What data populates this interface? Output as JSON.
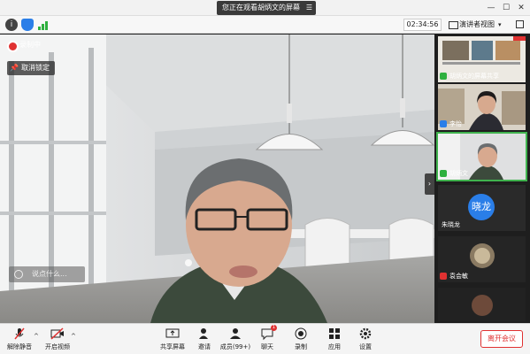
{
  "titlebar": {
    "share_banner": "您正在观看胡炳文的屏幕",
    "menu_glyph": "☰",
    "minimize": "—",
    "maximize": "☐",
    "close": "✕"
  },
  "toolbar": {
    "timer": "02:34:56",
    "speaker_view": "演讲者视图",
    "speaker_view_chevron": "▾"
  },
  "main": {
    "recording": "录制中",
    "unpin": "取消锁定",
    "chat_placeholder": "说点什么...",
    "collapse": "›"
  },
  "participants": [
    {
      "name": "胡炳文的屏幕共享",
      "mic": "green",
      "type": "screen"
    },
    {
      "name": "李怡",
      "mic": "blue",
      "type": "video"
    },
    {
      "name": "胡炳文",
      "mic": "green",
      "type": "video"
    },
    {
      "name": "朱晓龙",
      "mic": "none",
      "type": "avatar",
      "avatar_text": "晓龙"
    },
    {
      "name": "袁会敏",
      "mic": "red",
      "type": "video"
    },
    {
      "name": "",
      "mic": "none",
      "type": "video"
    }
  ],
  "bottombar": {
    "unmute": "解除静音",
    "start_video": "开启视频",
    "share_screen": "共享屏幕",
    "invite": "邀请",
    "members": "成员(99+)",
    "chat": "聊天",
    "chat_badge": "1",
    "record": "录制",
    "apps": "应用",
    "settings": "设置",
    "leave": "离开会议"
  },
  "colors": {
    "accent_green": "#2eb03e",
    "accent_blue": "#2a7ee8",
    "danger_red": "#e03131"
  }
}
